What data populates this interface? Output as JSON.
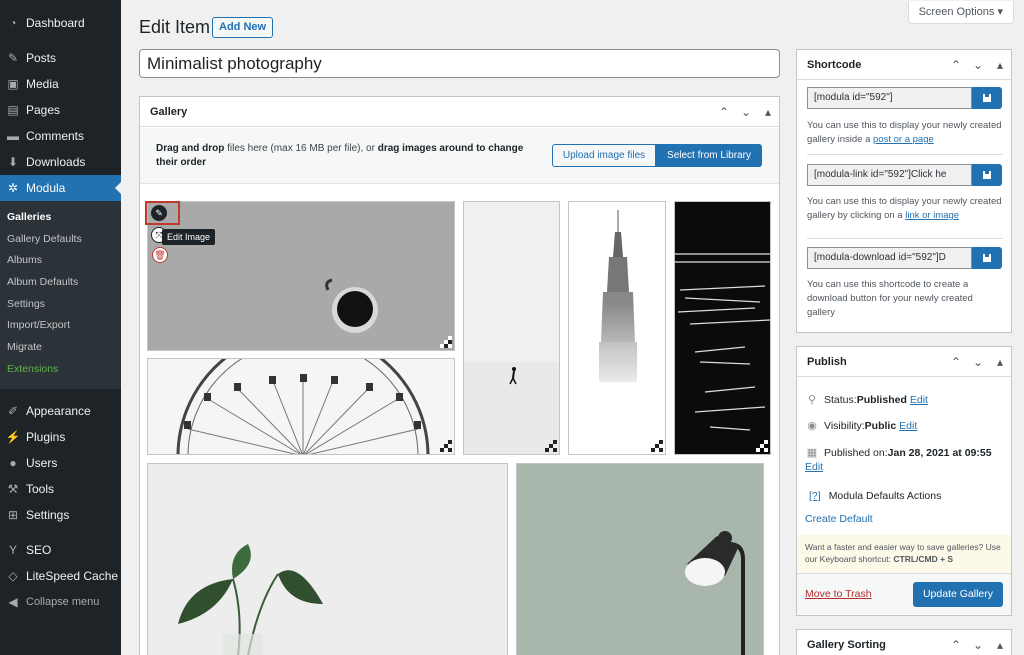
{
  "sidebar": {
    "items_top": [
      {
        "label": "Dashboard",
        "icon": "dashboard-icon"
      },
      {
        "label": "Posts",
        "icon": "pin-icon"
      },
      {
        "label": "Media",
        "icon": "media-icon"
      },
      {
        "label": "Pages",
        "icon": "pages-icon"
      },
      {
        "label": "Comments",
        "icon": "comment-icon"
      },
      {
        "label": "Downloads",
        "icon": "download-icon"
      },
      {
        "label": "Modula",
        "icon": "gear-icon"
      }
    ],
    "submenu": [
      "Galleries",
      "Gallery Defaults",
      "Albums",
      "Album Defaults",
      "Settings",
      "Import/Export",
      "Migrate",
      "Extensions"
    ],
    "items_bottom": [
      {
        "label": "Appearance",
        "icon": "brush-icon"
      },
      {
        "label": "Plugins",
        "icon": "plugin-icon"
      },
      {
        "label": "Users",
        "icon": "user-icon"
      },
      {
        "label": "Tools",
        "icon": "wrench-icon"
      },
      {
        "label": "Settings",
        "icon": "settings-icon"
      },
      {
        "label": "SEO",
        "icon": "seo-icon"
      },
      {
        "label": "LiteSpeed Cache",
        "icon": "diamond-icon"
      },
      {
        "label": "Collapse menu",
        "icon": "collapse-icon"
      }
    ]
  },
  "header": {
    "title": "Edit Item",
    "add_new": "Add New",
    "screen_options": "Screen Options ▾"
  },
  "post_title": "Minimalist photography",
  "gallery": {
    "title": "Gallery",
    "upload_text_bold1": "Drag and drop",
    "upload_text_1": " files here (max 16 MB per file), or ",
    "upload_text_bold2": "drag images around to change",
    "upload_text_2": "their order",
    "upload_btn": "Upload image files",
    "library_btn": "Select from Library",
    "tooltip": "Edit Image"
  },
  "shortcode": {
    "title": "Shortcode",
    "code1": "[modula id=\"592\"]",
    "desc1_a": "You can use this to display your newly created gallery inside a ",
    "desc1_link": "post or a page",
    "code2": "[modula-link id=\"592\"]Click he",
    "desc2_a": "You can use this to display your newly created gallery by clicking on a ",
    "desc2_link": "link or image",
    "code3": "[modula-download id=\"592\"]D",
    "desc3": "You can use this shortcode to create a download button for your newly created gallery"
  },
  "publish": {
    "title": "Publish",
    "status_label": "Status: ",
    "status_value": "Published",
    "visibility_label": "Visibility: ",
    "visibility_value": "Public",
    "published_label": "Published on: ",
    "published_value": "Jan 28, 2021 at 09:55",
    "edit": "Edit",
    "help": "[?]",
    "defaults_actions": "Modula Defaults Actions",
    "create_default": "Create Default",
    "hint": "Want a faster and easier way to save galleries? Use our Keyboard shortcut: ",
    "hint_keys": "CTRL/CMD + S",
    "move_to_trash": "Move to Trash",
    "update": "Update Gallery"
  },
  "sorting": {
    "title": "Gallery Sorting"
  },
  "colors": {
    "accent": "#2271b1",
    "sidebar_bg": "#1d2327",
    "highlight": "#c0392b"
  }
}
